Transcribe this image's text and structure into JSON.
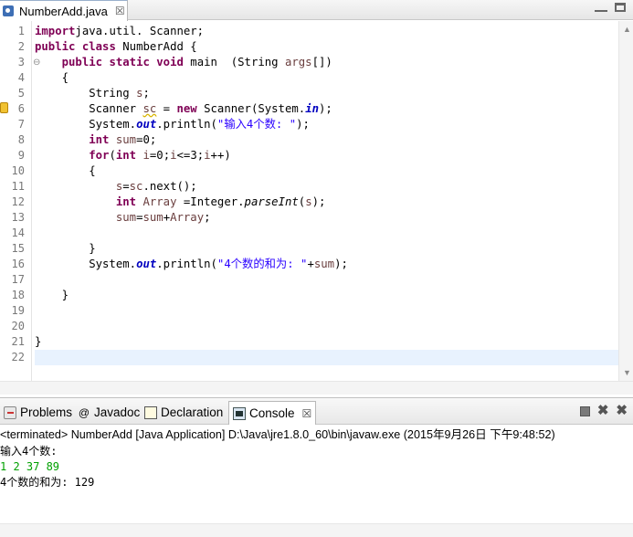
{
  "editor": {
    "tab": {
      "label": "NumberAdd.java",
      "close": "☒"
    },
    "lines": [
      {
        "n": "1",
        "segs": [
          [
            "kw",
            "import"
          ],
          [
            "",
            "java.util. Scanner;"
          ]
        ]
      },
      {
        "n": "2",
        "segs": [
          [
            "kw",
            "public"
          ],
          [
            "",
            " "
          ],
          [
            "kw",
            "class"
          ],
          [
            "",
            " NumberAdd {"
          ]
        ]
      },
      {
        "n": "3",
        "segs": [
          [
            "",
            "    "
          ],
          [
            "kw",
            "public"
          ],
          [
            "",
            " "
          ],
          [
            "kw",
            "static"
          ],
          [
            "",
            " "
          ],
          [
            "kw",
            "void"
          ],
          [
            "",
            " main  (String "
          ],
          [
            "var",
            "args"
          ],
          [
            "",
            "[])"
          ]
        ]
      },
      {
        "n": "4",
        "segs": [
          [
            "",
            "    {"
          ]
        ]
      },
      {
        "n": "5",
        "segs": [
          [
            "",
            "        String "
          ],
          [
            "var",
            "s"
          ],
          [
            "",
            ";"
          ]
        ]
      },
      {
        "n": "6",
        "segs": [
          [
            "",
            "        Scanner "
          ],
          [
            "var under",
            "sc"
          ],
          [
            "",
            " = "
          ],
          [
            "kw",
            "new"
          ],
          [
            "",
            " Scanner(System."
          ],
          [
            "fldb",
            "in"
          ],
          [
            "",
            ");"
          ]
        ]
      },
      {
        "n": "7",
        "segs": [
          [
            "",
            "        System."
          ],
          [
            "fldb",
            "out"
          ],
          [
            "",
            ".println("
          ],
          [
            "str",
            "\"输入4个数: \""
          ],
          [
            "",
            ");"
          ]
        ]
      },
      {
        "n": "8",
        "segs": [
          [
            "",
            "        "
          ],
          [
            "kw",
            "int"
          ],
          [
            "",
            " "
          ],
          [
            "var",
            "sum"
          ],
          [
            "",
            "=0;"
          ]
        ]
      },
      {
        "n": "9",
        "segs": [
          [
            "",
            "        "
          ],
          [
            "kw",
            "for"
          ],
          [
            "",
            "("
          ],
          [
            "kw",
            "int"
          ],
          [
            "",
            " "
          ],
          [
            "var",
            "i"
          ],
          [
            "",
            "=0;"
          ],
          [
            "var",
            "i"
          ],
          [
            "",
            "<=3;"
          ],
          [
            "var",
            "i"
          ],
          [
            "",
            "++)"
          ]
        ]
      },
      {
        "n": "10",
        "segs": [
          [
            "",
            "        {"
          ]
        ]
      },
      {
        "n": "11",
        "segs": [
          [
            "",
            "            "
          ],
          [
            "var",
            "s"
          ],
          [
            "",
            "="
          ],
          [
            "var",
            "sc"
          ],
          [
            "",
            ".next();"
          ]
        ]
      },
      {
        "n": "12",
        "segs": [
          [
            "",
            "            "
          ],
          [
            "kw",
            "int"
          ],
          [
            "",
            " "
          ],
          [
            "var",
            "Array"
          ],
          [
            "",
            " =Integer."
          ],
          [
            "mth",
            "parseInt"
          ],
          [
            "",
            "("
          ],
          [
            "var",
            "s"
          ],
          [
            "",
            ");"
          ]
        ]
      },
      {
        "n": "13",
        "segs": [
          [
            "",
            "            "
          ],
          [
            "var",
            "sum"
          ],
          [
            "",
            "="
          ],
          [
            "var",
            "sum"
          ],
          [
            "",
            "+"
          ],
          [
            "var",
            "Array"
          ],
          [
            "",
            ";"
          ]
        ]
      },
      {
        "n": "14",
        "segs": []
      },
      {
        "n": "15",
        "segs": [
          [
            "",
            "        }"
          ]
        ]
      },
      {
        "n": "16",
        "segs": [
          [
            "",
            "        System."
          ],
          [
            "fldb",
            "out"
          ],
          [
            "",
            ".println("
          ],
          [
            "str",
            "\"4个数的和为: \""
          ],
          [
            "",
            "+"
          ],
          [
            "var",
            "sum"
          ],
          [
            "",
            ");"
          ]
        ]
      },
      {
        "n": "17",
        "segs": []
      },
      {
        "n": "18",
        "segs": [
          [
            "",
            "    }"
          ]
        ]
      },
      {
        "n": "19",
        "segs": []
      },
      {
        "n": "20",
        "segs": []
      },
      {
        "n": "21",
        "segs": [
          [
            "",
            "}"
          ]
        ]
      },
      {
        "n": "22",
        "segs": []
      }
    ],
    "current_line": 22
  },
  "panel": {
    "tabs": [
      {
        "id": "problems",
        "label": "Problems",
        "icon": "problems-icon"
      },
      {
        "id": "javadoc",
        "label": "Javadoc",
        "icon": "at-icon",
        "glyph": "@"
      },
      {
        "id": "declaration",
        "label": "Declaration",
        "icon": "declaration-icon"
      },
      {
        "id": "console",
        "label": "Console",
        "icon": "console-icon",
        "active": true,
        "close": "☒"
      }
    ],
    "console": {
      "header": "<terminated> NumberAdd [Java Application] D:\\Java\\jre1.8.0_60\\bin\\javaw.exe (2015年9月26日 下午9:48:52)",
      "output": [
        {
          "text": "输入4个数:",
          "kind": "out"
        },
        {
          "text": "1 2 37 89",
          "kind": "input"
        },
        {
          "text": "4个数的和为: 129",
          "kind": "out"
        }
      ]
    },
    "tools": {
      "remove_glyph": "✖",
      "remove_all_glyph": "✖"
    }
  }
}
